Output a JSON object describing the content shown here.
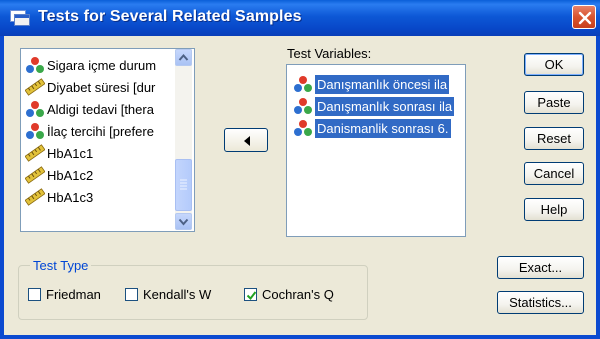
{
  "window": {
    "title": "Tests for Several Related Samples"
  },
  "source_list": {
    "items": [
      {
        "label": "Sigara içme durum",
        "icon": "nominal-variable-icon"
      },
      {
        "label": "Diyabet süresi [dur",
        "icon": "scale-variable-icon"
      },
      {
        "label": "Aldigi tedavi [thera",
        "icon": "nominal-variable-icon"
      },
      {
        "label": "İlaç tercihi [prefere",
        "icon": "nominal-variable-icon"
      },
      {
        "label": "HbA1c1",
        "icon": "scale-variable-icon"
      },
      {
        "label": "HbA1c2",
        "icon": "scale-variable-icon"
      },
      {
        "label": "HbA1c3",
        "icon": "scale-variable-icon"
      }
    ]
  },
  "test_variables": {
    "label": "Test Variables:",
    "items": [
      {
        "label": "Danışmanlık öncesi ila",
        "icon": "nominal-variable-icon"
      },
      {
        "label": "Danışmanlık sonrası ila",
        "icon": "nominal-variable-icon"
      },
      {
        "label": "Danismanlik sonrası 6.",
        "icon": "nominal-variable-icon"
      }
    ]
  },
  "buttons": {
    "ok": "OK",
    "paste": "Paste",
    "reset": "Reset",
    "cancel": "Cancel",
    "help": "Help",
    "exact": "Exact...",
    "statistics": "Statistics..."
  },
  "test_type": {
    "title": "Test Type",
    "options": [
      {
        "label": "Friedman",
        "checked": false
      },
      {
        "label": "Kendall's W",
        "checked": false
      },
      {
        "label": "Cochran's Q",
        "checked": true
      }
    ]
  },
  "colors": {
    "titlebar": "#0b4ad0",
    "selection": "#316ac5",
    "group_title": "#0046d5"
  }
}
